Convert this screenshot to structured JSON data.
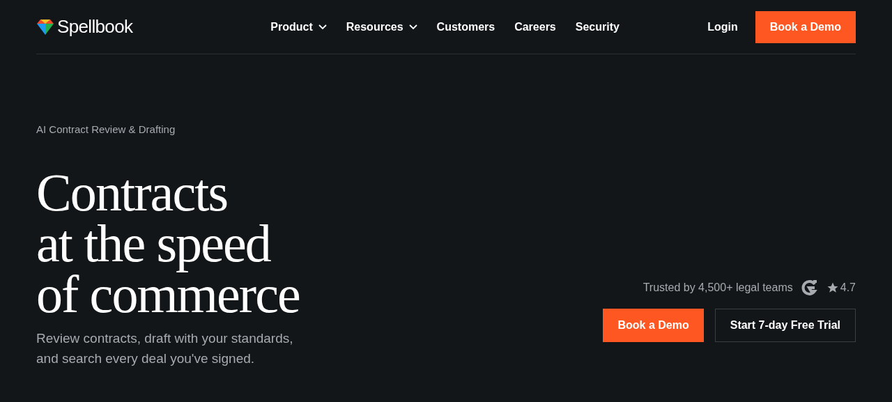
{
  "logo": {
    "text": "Spellbook"
  },
  "nav": [
    {
      "label": "Product",
      "dropdown": true
    },
    {
      "label": "Resources",
      "dropdown": true
    },
    {
      "label": "Customers",
      "dropdown": false
    },
    {
      "label": "Careers",
      "dropdown": false
    },
    {
      "label": "Security",
      "dropdown": false
    }
  ],
  "header_actions": {
    "login": "Login",
    "demo": "Book a Demo"
  },
  "hero": {
    "eyebrow": "AI Contract Review & Drafting",
    "headline": [
      "Contracts",
      "at the speed",
      "of commerce"
    ],
    "subtitle": [
      "Review contracts, draft with your standards,",
      "and search every deal you've signed."
    ]
  },
  "trust": {
    "text": "Trusted by 4,500+ legal teams",
    "rating": "4.7"
  },
  "cta": {
    "primary": "Book a Demo",
    "secondary": "Start 7-day Free Trial"
  }
}
